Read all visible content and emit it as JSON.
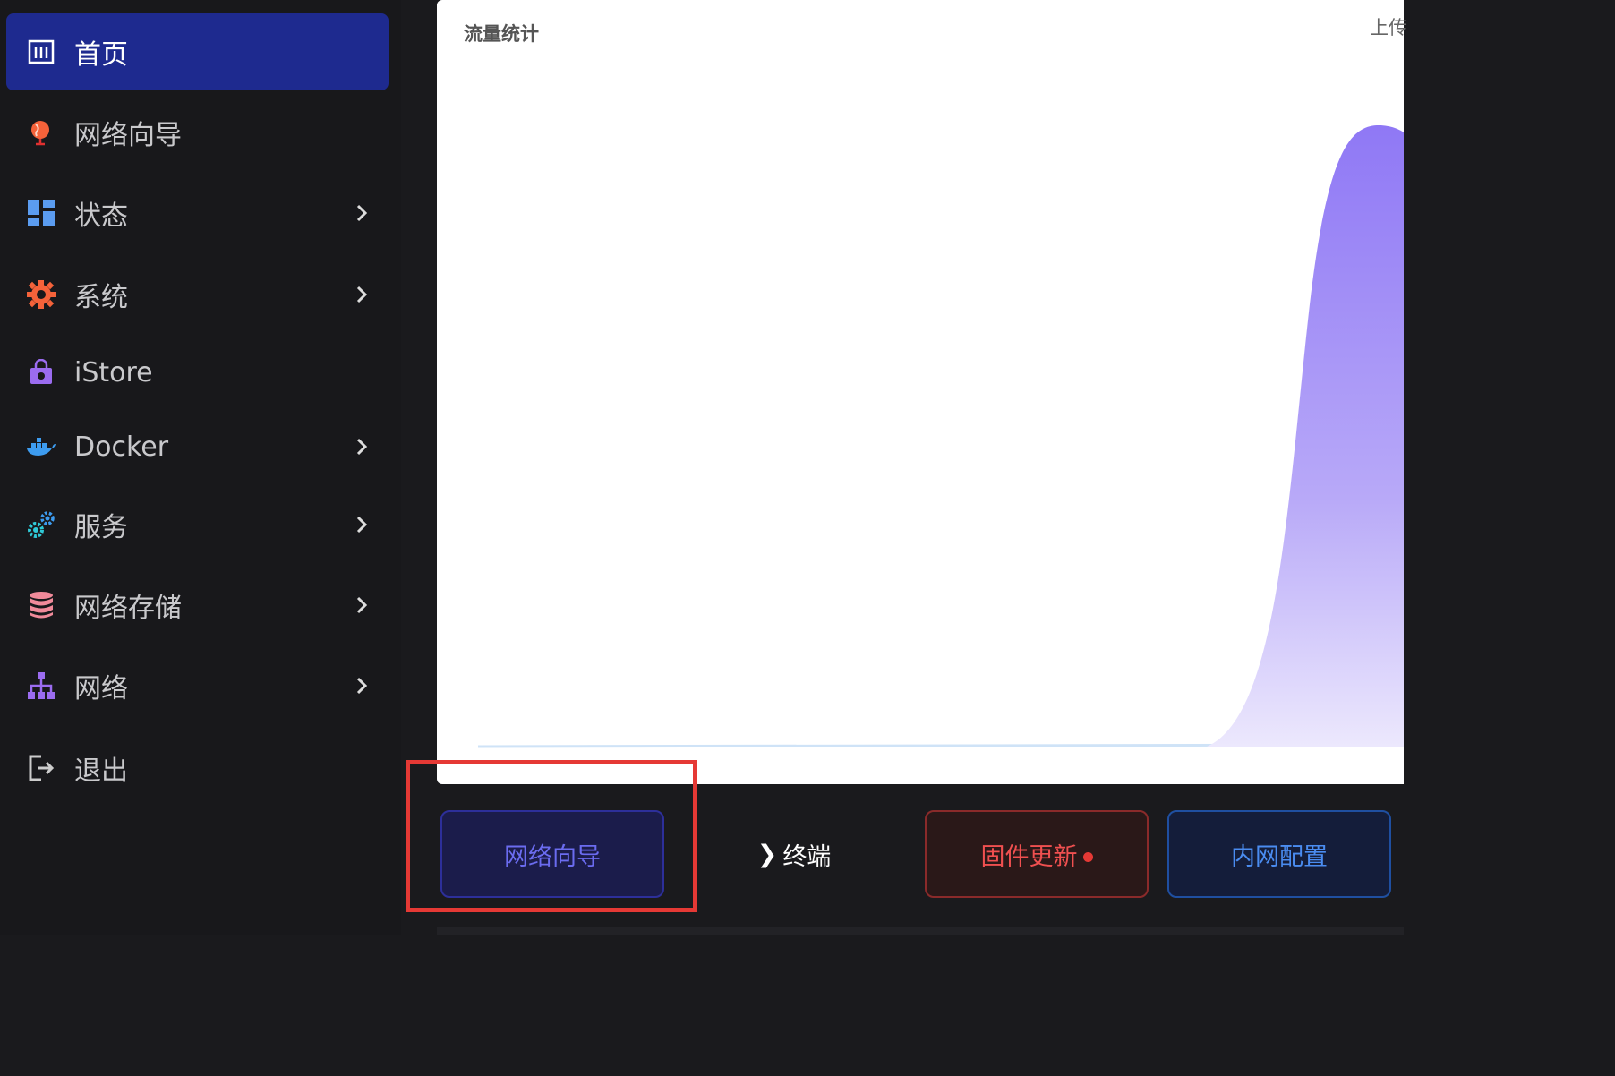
{
  "sidebar": {
    "items": [
      {
        "label": "首页",
        "icon": "dashboard-icon",
        "active": true,
        "has_submenu": false
      },
      {
        "label": "网络向导",
        "icon": "globe-icon",
        "active": false,
        "has_submenu": false
      },
      {
        "label": "状态",
        "icon": "status-grid-icon",
        "active": false,
        "has_submenu": true
      },
      {
        "label": "系统",
        "icon": "gear-icon",
        "active": false,
        "has_submenu": true
      },
      {
        "label": "iStore",
        "icon": "shopping-bag-icon",
        "active": false,
        "has_submenu": false
      },
      {
        "label": "Docker",
        "icon": "docker-icon",
        "active": false,
        "has_submenu": true
      },
      {
        "label": "服务",
        "icon": "services-cogs-icon",
        "active": false,
        "has_submenu": true
      },
      {
        "label": "网络存储",
        "icon": "database-icon",
        "active": false,
        "has_submenu": true
      },
      {
        "label": "网络",
        "icon": "network-tree-icon",
        "active": false,
        "has_submenu": true
      },
      {
        "label": "退出",
        "icon": "logout-icon",
        "active": false,
        "has_submenu": false
      }
    ]
  },
  "main": {
    "title": "流量统计",
    "legend_upload": "上传"
  },
  "actions": {
    "wizard": "网络向导",
    "terminal": "终端",
    "terminal_prefix": "❯",
    "firmware": "固件更新",
    "lan": "内网配置"
  },
  "colors": {
    "accent": "#1e2a8f",
    "chart_fill": "#9b87f5",
    "highlight": "#e53935"
  }
}
